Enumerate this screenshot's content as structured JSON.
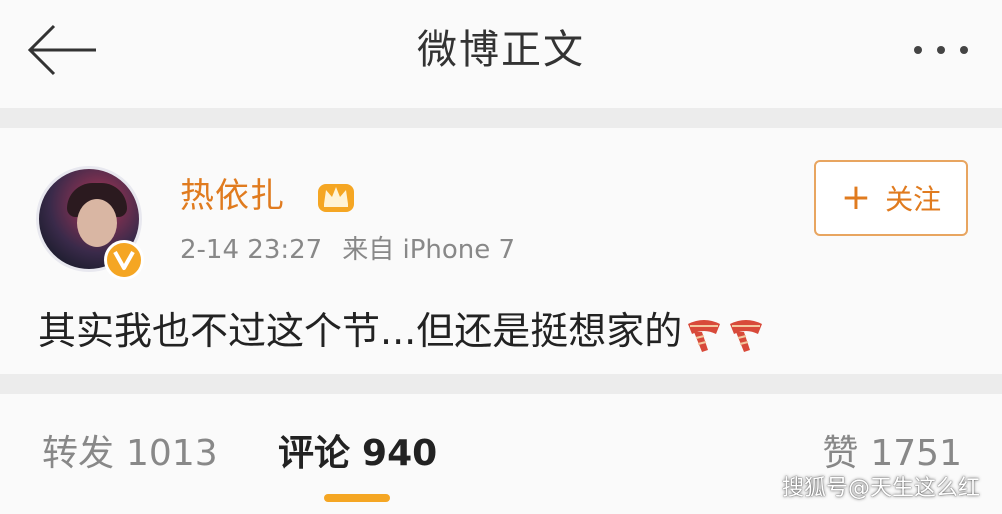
{
  "header": {
    "title": "微博正文",
    "back_icon": "back-arrow-icon",
    "more_icon": "more-dots-icon"
  },
  "post": {
    "username": "热依扎",
    "badge": "crown-icon",
    "verified_icon": "verified-v-icon",
    "date": "2-14 23:27",
    "source": "来自 iPhone 7",
    "follow_label": "关注",
    "follow_icon": "plus-icon",
    "text": "其实我也不过这个节...但还是挺想家的",
    "emoji": [
      "scarf-emoji",
      "scarf-emoji"
    ]
  },
  "tabs": {
    "forward_label": "转发",
    "forward_count": "1013",
    "comment_label": "评论",
    "comment_count": "940",
    "like_label": "赞",
    "like_count": "1751",
    "active": "评论"
  },
  "watermark": "搜狐号@天生这么红",
  "colors": {
    "accent": "#f5a623",
    "username": "#e07b1f",
    "background": "#fafafa",
    "separator": "#ececec"
  }
}
